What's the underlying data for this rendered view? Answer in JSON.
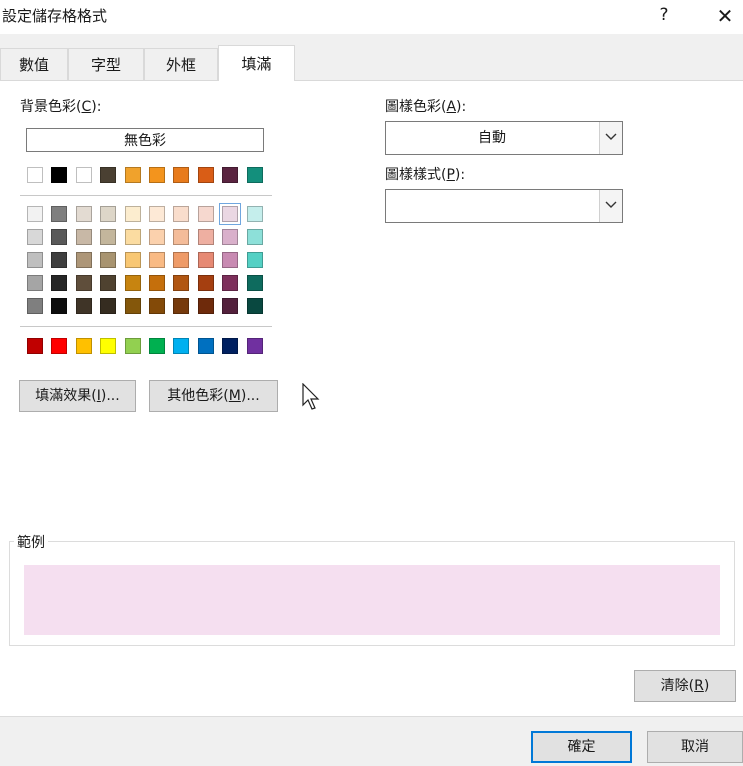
{
  "dialog": {
    "title": "設定儲存格格式",
    "help_label": "?",
    "close_label": "✕"
  },
  "tabs": [
    {
      "label": "數值",
      "active": false
    },
    {
      "label": "字型",
      "active": false
    },
    {
      "label": "外框",
      "active": false
    },
    {
      "label": "填滿",
      "active": true
    }
  ],
  "fill": {
    "background_label": "背景色彩",
    "background_key": "C",
    "no_color_label": "無色彩",
    "theme_top_row": [
      "#ffffff",
      "#000000",
      "#ffffff",
      "#4a4032",
      "#f0a22c",
      "#f3941d",
      "#e87b1c",
      "#d95d16",
      "#5a2440",
      "#138f7c"
    ],
    "theme_grid": [
      [
        "#f2f2f2",
        "#7f7f7f",
        "#e3dbd2",
        "#ddd6c8",
        "#fcedcf",
        "#fde9d6",
        "#f9ddcc",
        "#f6d8cf",
        "#ead7e3",
        "#c5eeec"
      ],
      [
        "#d8d8d8",
        "#595959",
        "#c8b8a6",
        "#c3b69c",
        "#fbdca1",
        "#fbd1ad",
        "#f4bc99",
        "#eeafa1",
        "#d9b0cb",
        "#8de0d9"
      ],
      [
        "#bfbfbf",
        "#3f3f3f",
        "#ad9678",
        "#a89470",
        "#f8c773",
        "#f9ba84",
        "#ee9b68",
        "#e68973",
        "#c88ab2",
        "#54d0c4"
      ],
      [
        "#a5a5a5",
        "#262626",
        "#5f4e3b",
        "#4f4230",
        "#c78410",
        "#c56f0c",
        "#b15612",
        "#a53f10",
        "#7d2f5b",
        "#0e6b5e"
      ],
      [
        "#7f7f7f",
        "#0d0d0d",
        "#3f3427",
        "#352c20",
        "#84570b",
        "#834a08",
        "#763a0c",
        "#6e2a0b",
        "#53203c",
        "#094840"
      ]
    ],
    "selected_swatch": {
      "row": 0,
      "col": 8
    },
    "standard_colors": [
      "#c00000",
      "#ff0000",
      "#ffc000",
      "#ffff00",
      "#92d050",
      "#00b050",
      "#00b0f0",
      "#0070c0",
      "#002060",
      "#7030a0"
    ],
    "fill_effects_label": "填滿效果",
    "fill_effects_key": "I",
    "more_colors_label": "其他色彩",
    "more_colors_key": "M",
    "ellipsis": "...",
    "pattern_color_label": "圖樣色彩",
    "pattern_color_key": "A",
    "pattern_color_value": "自動",
    "pattern_style_label": "圖樣樣式",
    "pattern_style_key": "P",
    "pattern_style_value": ""
  },
  "sample": {
    "label": "範例",
    "color": "#f5dff0"
  },
  "buttons": {
    "clear_label": "清除",
    "clear_key": "R",
    "ok_label": "確定",
    "cancel_label": "取消"
  }
}
